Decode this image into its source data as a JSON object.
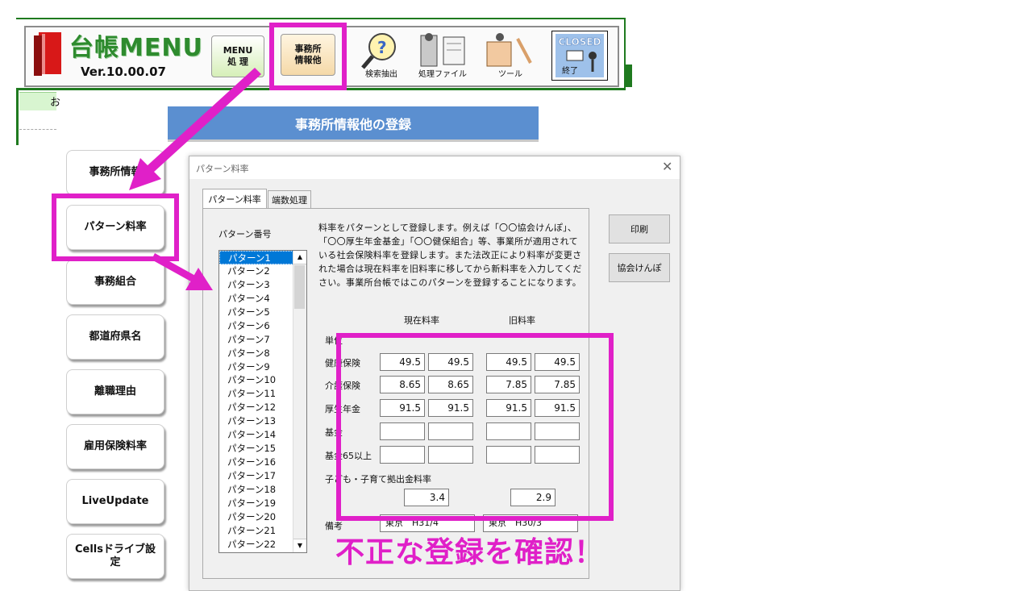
{
  "menubar": {
    "title": "台帳MENU",
    "version": "Ver.10.00.07",
    "menu_button": [
      "MENU",
      "処 理"
    ],
    "office_button": [
      "事務所",
      "情報他"
    ],
    "search_label": "検索抽出",
    "file_label": "処理ファイル",
    "tool_label": "ツール",
    "closed_label": "CLOSED",
    "end_label": "終了"
  },
  "sheet": {
    "cell_char": "お"
  },
  "banner": {
    "title": "事務所情報他の登録"
  },
  "sidebar": {
    "items": [
      {
        "label": "事務所情報"
      },
      {
        "label": "パターン料率"
      },
      {
        "label": "事務組合"
      },
      {
        "label": "都道府県名"
      },
      {
        "label": "離職理由"
      },
      {
        "label": "雇用保険料率"
      },
      {
        "label": "LiveUpdate"
      },
      {
        "label": "Cellsドライブ設定"
      }
    ]
  },
  "dialog": {
    "title": "パターン料率",
    "close": "✕",
    "tabs": [
      "パターン料率",
      "端数処理"
    ],
    "pattern_no_label": "パターン番号",
    "patterns": [
      "パターン1",
      "パターン2",
      "パターン3",
      "パターン4",
      "パターン5",
      "パターン6",
      "パターン7",
      "パターン8",
      "パターン9",
      "パターン10",
      "パターン11",
      "パターン12",
      "パターン13",
      "パターン14",
      "パターン15",
      "パターン16",
      "パターン17",
      "パターン18",
      "パターン19",
      "パターン20",
      "パターン21",
      "パターン22"
    ],
    "description": "料率をパターンとして登録します。例えば「〇〇協会けんぽ」、「〇〇厚生年金基金」「〇〇健保組合」等、事業所が適用されている社会保険料率を登録します。また法改正により料率が変更された場合は現在料率を旧料率に移してから新料率を入力してください。事業所台帳ではこのパターンを登録することになります。",
    "current_header": "現在料率",
    "old_header": "旧料率",
    "unit_label": "単位",
    "rows": [
      {
        "label": "健康保険",
        "values": [
          "49.5",
          "49.5",
          "49.5",
          "49.5"
        ]
      },
      {
        "label": "介護保険",
        "values": [
          "8.65",
          "8.65",
          "7.85",
          "7.85"
        ]
      },
      {
        "label": "厚生年金",
        "values": [
          "91.5",
          "91.5",
          "91.5",
          "91.5"
        ]
      },
      {
        "label": "基金",
        "values": [
          "",
          "",
          "",
          ""
        ]
      },
      {
        "label": "基金65以上",
        "values": [
          "",
          "",
          "",
          ""
        ]
      }
    ],
    "child_label": "子ども・子育て拠出金料率",
    "child_current": "3.4",
    "child_old": "2.9",
    "remarks_label": "備考",
    "remark_current": "東京　H31/4",
    "remark_old": "東京　H30/3",
    "print_button": "印刷",
    "kyokai_button": "協会けんぽ"
  },
  "annotation": {
    "warning": "不正な登録を確認！"
  },
  "colors": {
    "highlight": "#e020c8",
    "banner": "#5b8fd0",
    "brand_green": "#2e8b2e",
    "selection": "#0078d7"
  }
}
